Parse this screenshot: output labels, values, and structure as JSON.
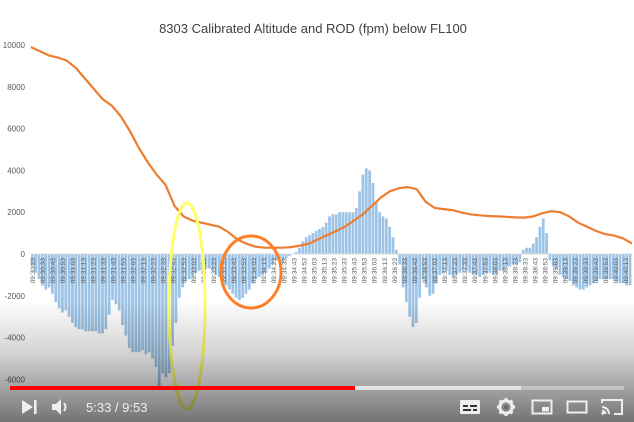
{
  "player": {
    "time_current": "5:33",
    "time_separator": " / ",
    "time_duration": "9:53",
    "progress_played": 0.5615,
    "progress_buffered": 0.833,
    "colors": {
      "played": "#ff0000"
    },
    "controls": [
      "next-icon",
      "volume-icon",
      "subtitles-icon",
      "settings-icon",
      "miniplayer-icon",
      "theater-mode-icon",
      "cast-icon"
    ]
  },
  "chart_data": {
    "type": "bar+line",
    "title": "8303 Calibrated Altitude and ROD (fpm) below FL100",
    "ylim": [
      -6500,
      10500
    ],
    "yticks": [
      "10000",
      "8000",
      "6000",
      "4000",
      "2000",
      "0",
      "-2000",
      "-4000",
      "-6000"
    ],
    "ytick_values": [
      10000,
      8000,
      6000,
      4000,
      2000,
      0,
      -2000,
      -4000,
      -6000
    ],
    "xticks": [
      "09:30:23",
      "09:30:33",
      "09:30:43",
      "09:30:53",
      "09:31:03",
      "09:31:13",
      "09:31:23",
      "09:31:33",
      "09:31:43",
      "09:31:53",
      "09:32:03",
      "09:32:13",
      "09:32:23",
      "09:32:33",
      "09:32:43",
      "09:32:53",
      "09:33:03",
      "09:33:13",
      "09:33:23",
      "09:33:33",
      "09:33:43",
      "09:33:53",
      "09:34:03",
      "09:34:13",
      "09:34:23",
      "09:34:33",
      "09:34:43",
      "09:34:53",
      "09:35:03",
      "09:35:13",
      "09:35:23",
      "09:35:33",
      "09:35:43",
      "09:35:53",
      "09:36:03",
      "09:36:13",
      "09:36:23",
      "09:36:33",
      "09:36:43",
      "09:36:53",
      "09:37:03",
      "09:37:13",
      "09:37:23",
      "09:37:33",
      "09:37:43",
      "09:37:53",
      "09:38:03",
      "09:38:13",
      "09:38:23",
      "09:38:33",
      "09:38:43",
      "09:38:53",
      "09:39:03",
      "09:39:13",
      "09:39:23",
      "09:39:33",
      "09:39:43",
      "09:39:53",
      "09:40:03",
      "09:40:13"
    ],
    "series": [
      {
        "type": "bar",
        "color": "#9dc3e6",
        "values": [
          -600,
          -900,
          -1200,
          -1500,
          -1700,
          -1600,
          -1900,
          -2300,
          -2600,
          -2800,
          -2700,
          -3000,
          -3300,
          -3500,
          -3600,
          -3600,
          -3700,
          -3700,
          -3700,
          -3700,
          -3800,
          -3800,
          -3600,
          -2900,
          -2200,
          -2400,
          -2700,
          -3400,
          -3900,
          -4500,
          -4700,
          -4700,
          -4700,
          -4600,
          -4800,
          -4700,
          -5000,
          -5400,
          -6400,
          -5700,
          -5900,
          -5700,
          -4400,
          -3300,
          -2100,
          -1600,
          -1300,
          -1200,
          -1100,
          -900,
          -800,
          -700,
          -700,
          -700,
          -800,
          -1000,
          -1100,
          -1300,
          -1500,
          -1700,
          -1900,
          -2100,
          -2200,
          -2100,
          -1900,
          -1700,
          -1400,
          -1200,
          -1100,
          -1000,
          -900,
          -700,
          -500,
          -300,
          -300,
          -400,
          -200,
          -100,
          0,
          100,
          300,
          600,
          800,
          900,
          1000,
          1100,
          1200,
          1300,
          1500,
          1800,
          1900,
          1900,
          2000,
          2000,
          2000,
          2000,
          2000,
          2200,
          3000,
          3800,
          4100,
          4000,
          3400,
          2500,
          2000,
          1800,
          1700,
          1300,
          800,
          200,
          -500,
          -1600,
          -2300,
          -3000,
          -3500,
          -3300,
          -2100,
          -1200,
          -1600,
          -2000,
          -1900,
          -1400,
          -1000,
          -900,
          -800,
          -1000,
          -1100,
          -1000,
          -900,
          -800,
          -800,
          -900,
          -1000,
          -1000,
          -1100,
          -1000,
          -900,
          -900,
          -1000,
          -1000,
          -800,
          -800,
          -600,
          -600,
          -500,
          -500,
          -400,
          200,
          300,
          300,
          500,
          800,
          1300,
          1700,
          1000,
          -300,
          -600,
          -700,
          -1000,
          -1100,
          -1200,
          -1300,
          -1500,
          -1600,
          -1700,
          -1700,
          -1600,
          -1500,
          -1400,
          -1300,
          -1200,
          -1200,
          -1200,
          -1200,
          -1200,
          -1300,
          -1400,
          -1400,
          -1500,
          -1500
        ]
      },
      {
        "type": "line",
        "color": "#ed7d31",
        "values": [
          9900,
          9700,
          9500,
          9400,
          9250,
          8900,
          8400,
          7900,
          7400,
          7100,
          6600,
          5900,
          5100,
          4400,
          3800,
          3300,
          2300,
          1800,
          1600,
          1500,
          1400,
          1300,
          1050,
          700,
          500,
          350,
          300,
          300,
          300,
          330,
          400,
          500,
          700,
          900,
          1100,
          1300,
          1600,
          1900,
          2300,
          2700,
          3000,
          3150,
          3200,
          3100,
          2500,
          2200,
          2150,
          2100,
          1980,
          1900,
          1850,
          1820,
          1800,
          1780,
          1750,
          1740,
          1800,
          1950,
          2050,
          2000,
          1800,
          1500,
          1300,
          1100,
          950,
          880,
          750,
          500
        ]
      }
    ]
  },
  "annotations": [
    {
      "shape": "ellipse",
      "color": "#ffff66"
    },
    {
      "shape": "ellipse",
      "color": "#ff7f27"
    }
  ]
}
